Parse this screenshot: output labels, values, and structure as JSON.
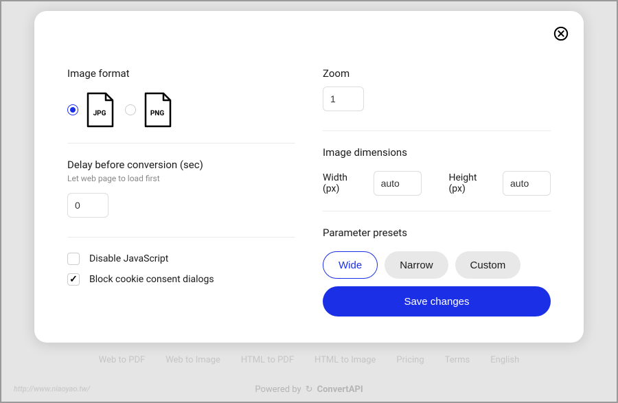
{
  "left": {
    "image_format_label": "Image format",
    "formats": {
      "jpg": "JPG",
      "png": "PNG"
    },
    "delay_label": "Delay before conversion (sec)",
    "delay_hint": "Let web page to load first",
    "delay_value": "0",
    "disable_js_label": "Disable JavaScript",
    "block_cookie_label": "Block cookie consent dialogs"
  },
  "right": {
    "zoom_label": "Zoom",
    "zoom_value": "1",
    "dimensions_label": "Image dimensions",
    "width_label": "Width (px)",
    "width_value": "auto",
    "height_label": "Height (px)",
    "height_value": "auto",
    "presets_label": "Parameter presets",
    "preset_wide": "Wide",
    "preset_narrow": "Narrow",
    "preset_custom": "Custom",
    "save_label": "Save changes"
  },
  "background": {
    "nav": {
      "web_to_pdf": "Web to PDF",
      "web_to_image": "Web to Image",
      "html_to_pdf": "HTML to PDF",
      "html_to_image": "HTML to Image",
      "pricing": "Pricing",
      "terms": "Terms",
      "english": "English"
    },
    "powered": "Powered by",
    "brand": "ConvertAPI",
    "watermark": "http://www.niaoyao.tw/"
  }
}
